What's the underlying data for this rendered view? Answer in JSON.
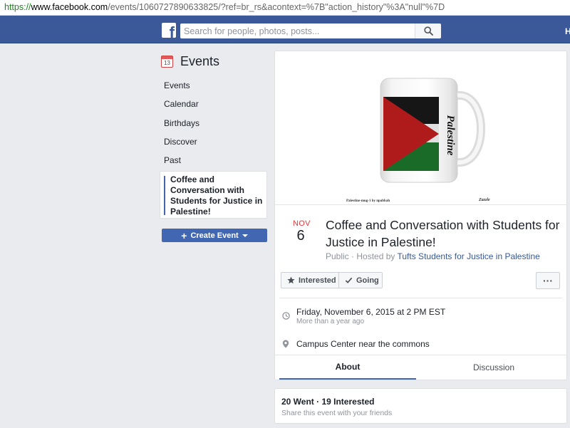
{
  "browser": {
    "url_protocol": "https://",
    "url_host": "www.facebook.com",
    "url_path": "/events/1060727890633825/?ref=br_rs&acontext=%7B\"action_history\"%3A\"null\"%7D"
  },
  "header": {
    "logo_letter": "f",
    "search_placeholder": "Search for people, photos, posts...",
    "right_fragment": "H"
  },
  "sidebar": {
    "calendar_day": "13",
    "title": "Events",
    "items": [
      {
        "label": "Events"
      },
      {
        "label": "Calendar"
      },
      {
        "label": "Birthdays"
      },
      {
        "label": "Discover"
      },
      {
        "label": "Past"
      }
    ],
    "active_event": "Coffee and Conversation with Students for Justice in Palestine!",
    "create_button": "Create Event"
  },
  "event": {
    "cover": {
      "mug_text": "Palestine",
      "caption_left": "Palestine-mug-1 by npabbah",
      "caption_right": "Zazzle"
    },
    "month": "NOV",
    "day": "6",
    "title": "Coffee and Conversation with Students for Justice in Palestine!",
    "privacy": "Public",
    "hosted_by_prefix": " · Hosted by ",
    "host": "Tufts Students for Justice in Palestine",
    "actions": {
      "interested": "Interested",
      "going": "Going",
      "more": "···"
    },
    "datetime": "Friday, November 6, 2015 at 2 PM EST",
    "relative_time": "More than a year ago",
    "location": "Campus Center near the commons",
    "tabs": [
      {
        "label": "About",
        "active": true
      },
      {
        "label": "Discussion",
        "active": false
      }
    ]
  },
  "stats": {
    "summary": "20 Went · 19 Interested",
    "share_prompt": "Share this event with your friends"
  },
  "colors": {
    "brand_blue": "#3b5998",
    "button_blue": "#4267b2",
    "link_blue": "#365899",
    "date_red": "#e0393e",
    "flag_red": "#ce1126",
    "flag_green": "#007a3d",
    "flag_black": "#000000"
  },
  "icons": [
    "facebook-logo-icon",
    "search-icon",
    "calendar-icon",
    "plus-icon",
    "caret-down-icon",
    "star-icon",
    "check-icon",
    "more-icon",
    "clock-icon",
    "location-pin-icon"
  ]
}
